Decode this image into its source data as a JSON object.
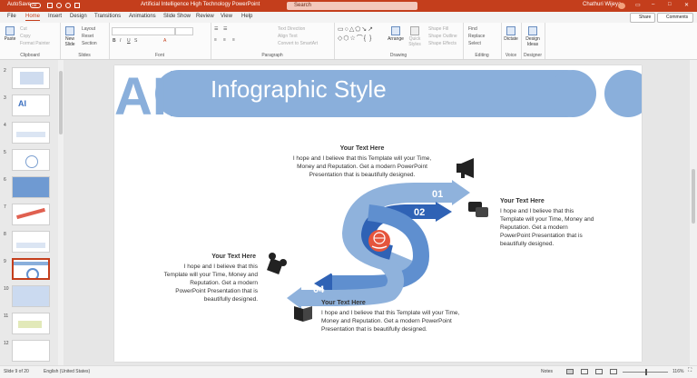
{
  "titlebar": {
    "autosave_label": "AutoSave",
    "autosave_state": "Off",
    "doc_title": "Artificial Intelligence High Technology PowerPoint",
    "search_placeholder": "Search",
    "user_name": "Chathuri Wijeya",
    "user_initials": "CW"
  },
  "tabs": [
    "File",
    "Home",
    "Insert",
    "Design",
    "Transitions",
    "Animations",
    "Slide Show",
    "Review",
    "View",
    "Help"
  ],
  "active_tab": "Home",
  "share_label": "Share",
  "comments_label": "Comments",
  "ribbon": {
    "clipboard": {
      "label": "Clipboard",
      "paste": "Paste",
      "cut": "Cut",
      "copy": "Copy",
      "format_painter": "Format Painter"
    },
    "slides": {
      "label": "Slides",
      "new_slide": "New Slide",
      "layout": "Layout",
      "reset": "Reset",
      "section": "Section"
    },
    "font": {
      "label": "Font"
    },
    "paragraph": {
      "label": "Paragraph",
      "text_direction": "Text Direction",
      "align_text": "Align Text",
      "convert_smartart": "Convert to SmartArt"
    },
    "drawing": {
      "label": "Drawing",
      "arrange": "Arrange",
      "quick_styles": "Quick Styles",
      "shape_fill": "Shape Fill",
      "shape_outline": "Shape Outline",
      "shape_effects": "Shape Effects"
    },
    "editing": {
      "label": "Editing",
      "find": "Find",
      "replace": "Replace",
      "select": "Select"
    },
    "voice": {
      "label": "Voice",
      "dictate": "Dictate"
    },
    "designer": {
      "label": "Designer",
      "design_ideas": "Design Ideas"
    }
  },
  "thumbnails": [
    "2",
    "3",
    "4",
    "5",
    "6",
    "7",
    "8",
    "9",
    "10",
    "11",
    "12"
  ],
  "selected_thumbnail": "9",
  "slide": {
    "banner_logo": "AI",
    "title": "Infographic Style",
    "steps": [
      "01",
      "02",
      "03",
      "04"
    ],
    "blocks": [
      {
        "heading": "Your Text  Here",
        "body": [
          "I hope and I believe that this Template will your Time,",
          "Money and Reputation. Get a modern PowerPoint",
          "Presentation that is beautifully designed."
        ]
      },
      {
        "heading": "Your Text  Here",
        "body": [
          "I hope and I believe that this",
          "Template will your Time, Money and",
          "Reputation. Get a modern",
          "PowerPoint  Presentation that is",
          "beautifully designed."
        ]
      },
      {
        "heading": "Your Text  Here",
        "body": [
          "I hope and I believe that this",
          "Template will your Time, Money and",
          "Reputation. Get a modern",
          "PowerPoint  Presentation that is",
          "beautifully designed."
        ]
      },
      {
        "heading": "Your Text  Here",
        "body": [
          "I hope and I believe that this Template will your Time,",
          "Money and Reputation. Get a modern PowerPoint",
          "Presentation that is beautifully designed."
        ]
      }
    ],
    "colors": {
      "light_blue": "#8fb2dc",
      "mid_blue": "#5f8fcf",
      "dark_blue": "#2f62b5",
      "banner_blue": "#8aafdb",
      "accent_red": "#e5553d"
    }
  },
  "status": {
    "slide_info": "Slide 9 of 20",
    "language": "English (United States)",
    "notes": "Notes",
    "zoom": "116%"
  }
}
